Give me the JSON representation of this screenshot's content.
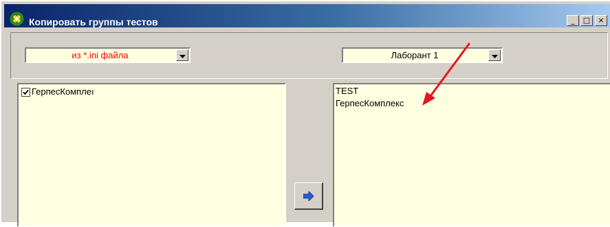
{
  "window": {
    "title": "Копировать группы тестов",
    "controls": {
      "minimize": "_",
      "maximize": "□",
      "close": "×"
    }
  },
  "source": {
    "selected": "из *.ini файла",
    "text_color": "#ff0000",
    "items": [
      {
        "label": "ГерпесКомплеı",
        "checked": true
      }
    ]
  },
  "target": {
    "selected": "Лаборант 1",
    "items": [
      {
        "label": "TEST"
      },
      {
        "label": "ГерпесКомплекс"
      }
    ]
  },
  "icons": {
    "app": "app-icon",
    "dropdown": "chevron-down-icon",
    "copy": "arrow-right-icon",
    "annotation": "annotation-arrow-icon"
  },
  "colors": {
    "title_start": "#0a246a",
    "title_end": "#a6caf0",
    "list_bg": "#ffffe1",
    "annotation": "#ff0000"
  }
}
